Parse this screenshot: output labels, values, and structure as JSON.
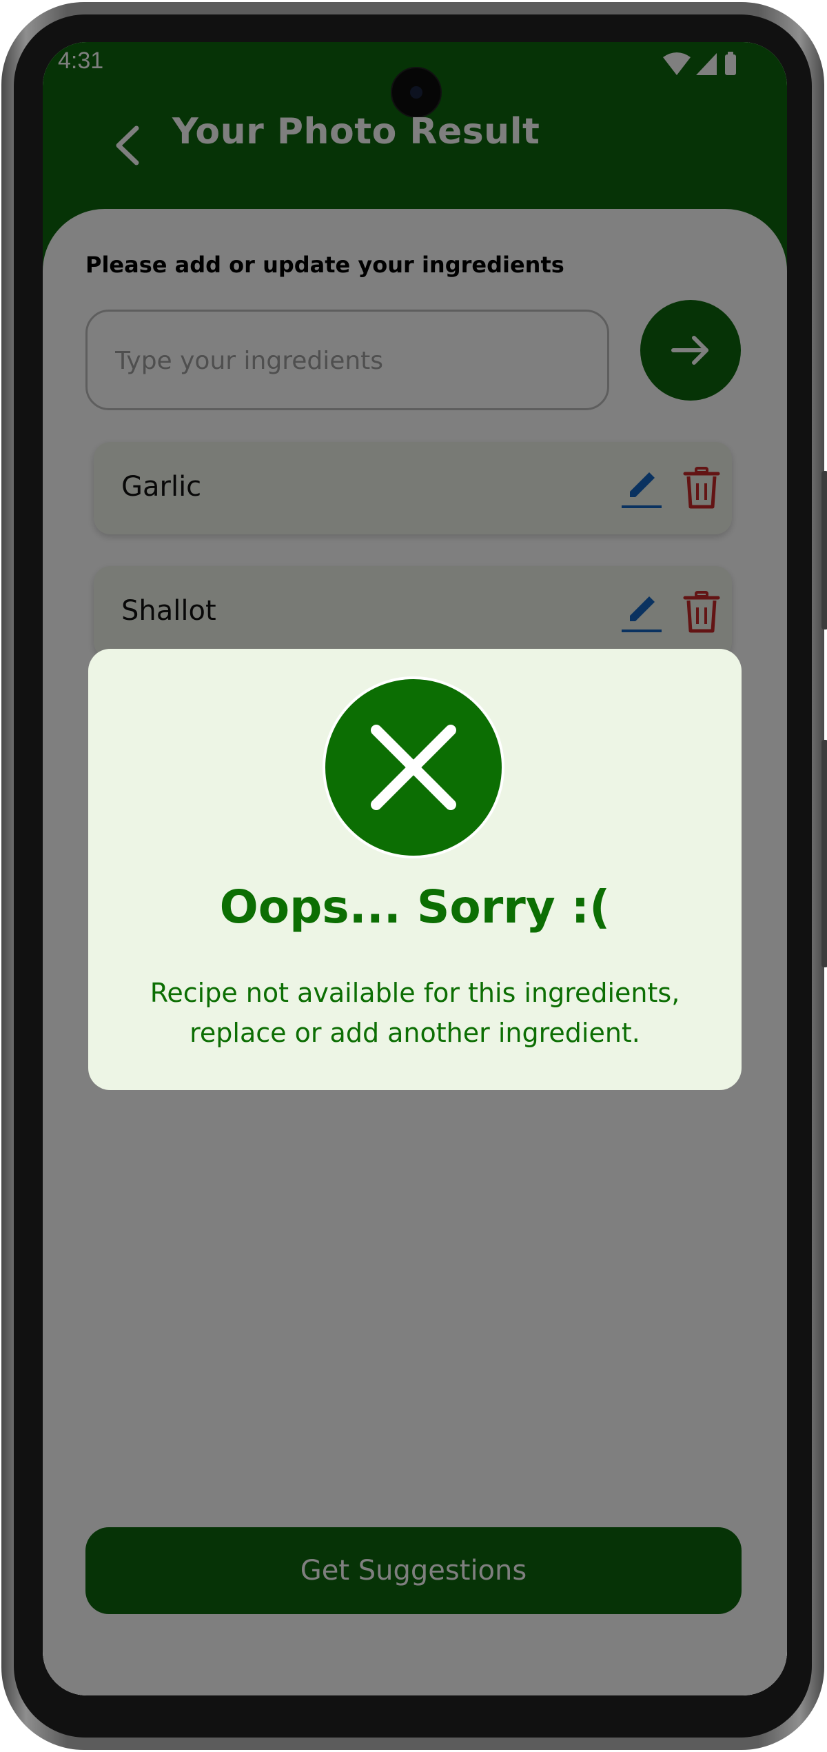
{
  "status_bar": {
    "time": "4:31"
  },
  "header": {
    "title": "Your Photo Result"
  },
  "form": {
    "label": "Please add or update your ingredients",
    "input_placeholder": "Type your ingredients",
    "input_value": ""
  },
  "ingredients": [
    {
      "name": "Garlic"
    },
    {
      "name": "Shallot"
    }
  ],
  "cta": {
    "label": "Get Suggestions"
  },
  "dialog": {
    "title": "Oops... Sorry :(",
    "message": "Recipe not available for this ingredients, replace or add another ingredient."
  },
  "icons": {
    "back": "chevron-left-icon",
    "send": "arrow-right-icon",
    "edit": "pencil-icon",
    "delete": "trash-icon",
    "error": "close-x-icon"
  },
  "colors": {
    "primary": "#0c660c",
    "dialog_accent": "#0c6e03",
    "dialog_background": "#edf5e5",
    "card_background": "#f1f5ea",
    "edit_icon": "#1565c0",
    "delete_icon": "#c62828"
  }
}
